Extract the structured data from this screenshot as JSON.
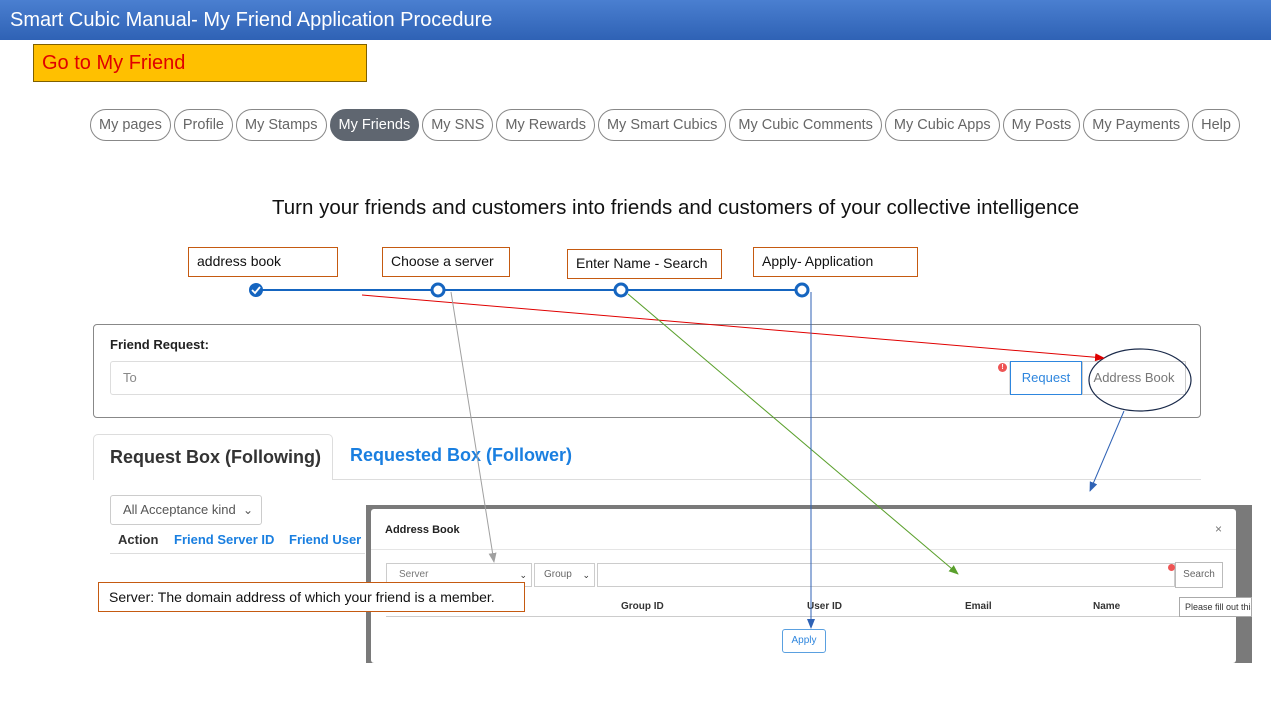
{
  "header": {
    "title": "Smart Cubic Manual- My Friend Application Procedure"
  },
  "callout": {
    "goto": "Go to My Friend"
  },
  "nav": {
    "items": [
      {
        "label": "My pages",
        "active": false
      },
      {
        "label": "Profile",
        "active": false
      },
      {
        "label": "My Stamps",
        "active": false
      },
      {
        "label": "My Friends",
        "active": true
      },
      {
        "label": "My SNS",
        "active": false
      },
      {
        "label": "My Rewards",
        "active": false
      },
      {
        "label": "My Smart Cubics",
        "active": false
      },
      {
        "label": "My Cubic Comments",
        "active": false
      },
      {
        "label": "My Cubic Apps",
        "active": false
      },
      {
        "label": "My Posts",
        "active": false
      },
      {
        "label": "My Payments",
        "active": false
      },
      {
        "label": "Help",
        "active": false
      }
    ]
  },
  "tagline": "Turn your friends and customers into friends and customers of your collective intelligence",
  "steps": [
    {
      "label": "address book",
      "completed": true
    },
    {
      "label": "Choose a server",
      "completed": false
    },
    {
      "label": "Enter Name - Search",
      "completed": false
    },
    {
      "label": "Apply- Application",
      "completed": false
    }
  ],
  "friend_request": {
    "title": "Friend Request:",
    "to_placeholder": "To",
    "request_button": "Request",
    "address_book_button": "Address Book",
    "warn_icon": "!"
  },
  "tabs": {
    "active": "Request Box (Following)",
    "other": "Requested Box (Follower)"
  },
  "filter": {
    "selected": "All Acceptance kind"
  },
  "table": {
    "columns": [
      "Action",
      "Friend Server ID",
      "Friend User I"
    ]
  },
  "modal": {
    "title": "Address Book",
    "close": "×",
    "server_placeholder": "Server",
    "group_placeholder": "Group",
    "search_button": "Search",
    "columns": [
      "Group ID",
      "User ID",
      "Email",
      "Name"
    ],
    "apply_button": "Apply",
    "tooltip": "Please fill out this field."
  },
  "notes": {
    "server": "Server: The domain address of which your friend is a member."
  },
  "colors": {
    "title_bar": "#2f62b5",
    "callout_bg": "#ffc000",
    "callout_text": "#e00000",
    "active_pill": "#5f6670",
    "link_blue": "#1a7fe0",
    "step_blue": "#1565c0",
    "arrow_red": "#e00000",
    "arrow_green": "#5aa02c",
    "arrow_gray": "#a0a0a0",
    "label_border": "#c55a11"
  }
}
